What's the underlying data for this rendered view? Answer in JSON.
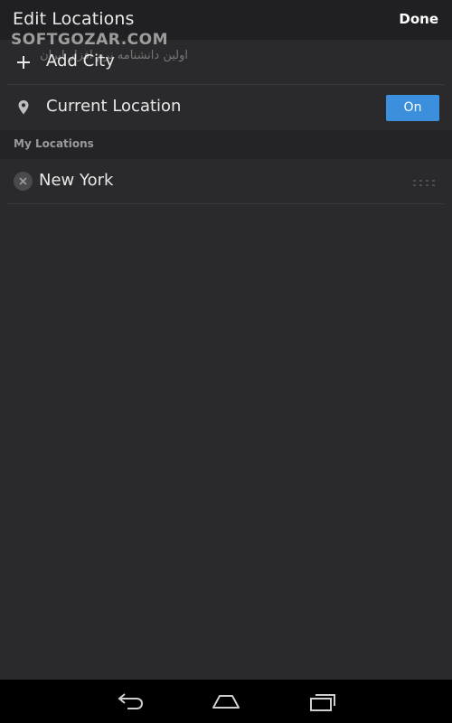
{
  "header": {
    "title": "Edit Locations",
    "done_label": "Done"
  },
  "watermark": {
    "brand": "SOFTGOZAR.COM",
    "subtitle": "اولین دانشنامه نرم افزار ایران"
  },
  "add_city": {
    "label": "Add City",
    "icon": "plus-icon"
  },
  "current_location": {
    "label": "Current Location",
    "icon": "map-pin-icon",
    "toggle_label": "On",
    "toggle_color": "#3b8fdc"
  },
  "my_locations": {
    "section_label": "My Locations",
    "items": [
      {
        "label": "New York",
        "remove_icon": "remove-icon",
        "drag_icon": "drag-handle-icon"
      }
    ]
  },
  "navbar": {
    "icons": [
      "back-icon",
      "home-icon",
      "recents-icon"
    ]
  },
  "colors": {
    "background": "#2a2a2c",
    "header": "#202022",
    "section_header": "#242426",
    "accent": "#3b8fdc",
    "navbar": "#000000"
  }
}
